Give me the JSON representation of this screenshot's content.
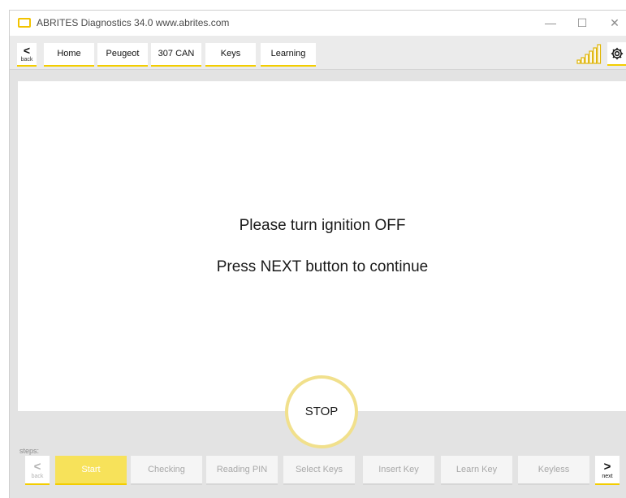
{
  "window": {
    "title": "ABRITES Diagnostics 34.0   www.abrites.com",
    "minimize_glyph": "—",
    "maximize_glyph": "☐",
    "close_glyph": "✕"
  },
  "nav": {
    "back_glyph": "<",
    "back_label": "back",
    "breadcrumbs": [
      "Home",
      "Peugeot",
      "307 CAN",
      "Keys",
      "Learning"
    ]
  },
  "main": {
    "line1": "Please turn ignition OFF",
    "line2": "Press NEXT button to continue"
  },
  "stop_label": "STOP",
  "steps": {
    "label": "steps:",
    "back_glyph": "<",
    "back_label": "back",
    "next_glyph": ">",
    "next_label": "next",
    "active_index": 0,
    "items": [
      "Start",
      "Checking",
      "Reading PIN",
      "Select Keys",
      "Insert Key",
      "Learn Key",
      "Keyless"
    ]
  },
  "colors": {
    "accent": "#f3cd00",
    "active_step": "#f7e25a",
    "stop_ring": "#f1e08c"
  },
  "icons": {
    "signal": "signal-strength-icon",
    "settings": "gear-icon"
  }
}
